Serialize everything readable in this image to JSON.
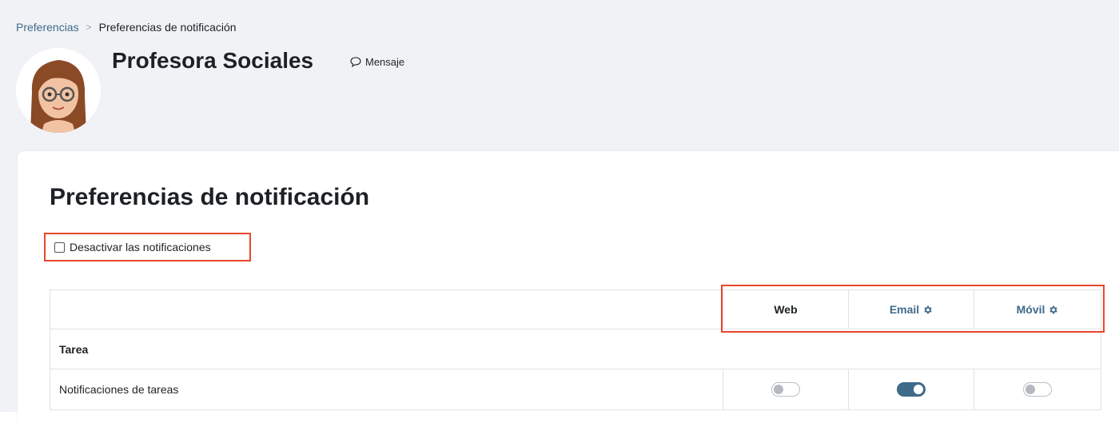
{
  "breadcrumb": {
    "items": [
      "Preferencias",
      "Preferencias de notificación"
    ]
  },
  "profile": {
    "name": "Profesora Sociales",
    "message_label": "Mensaje"
  },
  "page": {
    "title": "Preferencias de notificación",
    "disable_label": "Desactivar las notificaciones",
    "disable_checked": false
  },
  "table": {
    "processors": [
      {
        "label": "Web",
        "link": false
      },
      {
        "label": "Email",
        "link": true,
        "icon": "gear-icon"
      },
      {
        "label": "Móvil",
        "link": true,
        "icon": "gear-icon"
      }
    ],
    "section": "Tarea",
    "rows": [
      {
        "label": "Notificaciones de tareas",
        "states": [
          false,
          true,
          false
        ]
      }
    ]
  },
  "colors": {
    "accent": "#3f6a8a",
    "highlight": "#e8472c"
  }
}
